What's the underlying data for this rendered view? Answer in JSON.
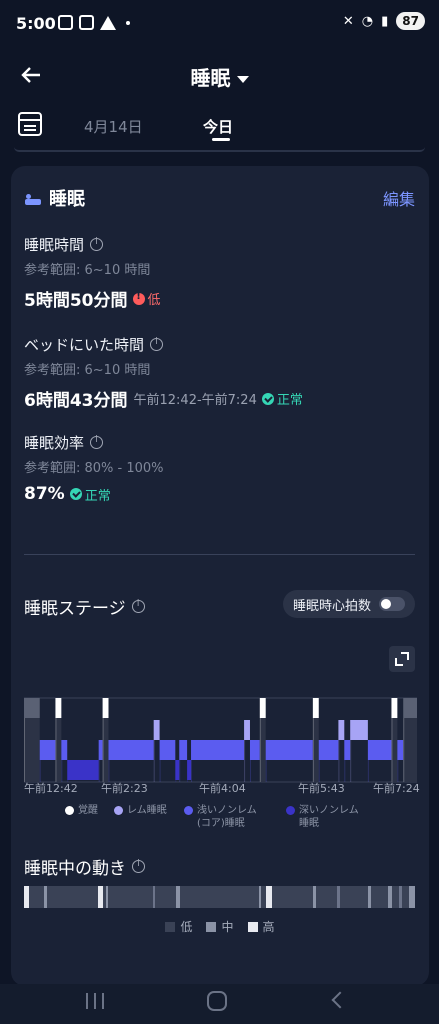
{
  "status_bar": {
    "time": "5:00",
    "battery": "87"
  },
  "header": {
    "title": "睡眠"
  },
  "date_tabs": {
    "prev": "4月14日",
    "current": "今日"
  },
  "card": {
    "title": "睡眠",
    "edit_label": "編集",
    "metrics": [
      {
        "label": "睡眠時間",
        "ref": "参考範囲: 6~10 時間",
        "value": "5時間50分間",
        "range": "",
        "badge": "低",
        "badge_type": "low"
      },
      {
        "label": "ベッドにいた時間",
        "ref": "参考範囲: 6~10 時間",
        "value": "6時間43分間",
        "range": "午前12:42-午前7:24",
        "badge": "正常",
        "badge_type": "ok"
      },
      {
        "label": "睡眠効率",
        "ref": "参考範囲: 80% - 100%",
        "value": "87%",
        "range": "",
        "badge": "正常",
        "badge_type": "ok"
      }
    ],
    "stages_title": "睡眠ステージ",
    "hr_toggle_label": "睡眠時心拍数",
    "time_labels": [
      "午前12:42",
      "午前2:23",
      "午前4:04",
      "午前5:43",
      "午前7:24"
    ],
    "legend": [
      {
        "label": "覚醒",
        "color": "#ffffff"
      },
      {
        "label": "レム睡眠",
        "color": "#a7a4f5"
      },
      {
        "label": "浅いノンレム\n(コア)睡眠",
        "color": "#5b5cf0"
      },
      {
        "label": "深いノンレム\n睡眠",
        "color": "#3a33c8"
      }
    ],
    "movement_title": "睡眠中の動き",
    "movement_legend": [
      "低",
      "中",
      "高"
    ]
  },
  "chart_data": {
    "type": "timeline",
    "title": "睡眠ステージ",
    "x_start": "午前12:42",
    "x_end": "午前7:24",
    "x_ticks": [
      "午前12:42",
      "午前2:23",
      "午前4:04",
      "午前5:43",
      "午前7:24"
    ],
    "stages": [
      "覚醒",
      "レム睡眠",
      "浅いノンレム(コア)睡眠",
      "深いノンレム睡眠"
    ],
    "segments": [
      {
        "stage": "覚醒",
        "start": 0.0,
        "end": 0.04
      },
      {
        "stage": "浅いノンレム(コア)睡眠",
        "start": 0.04,
        "end": 0.08
      },
      {
        "stage": "覚醒",
        "start": 0.08,
        "end": 0.095
      },
      {
        "stage": "浅いノンレム(コア)睡眠",
        "start": 0.095,
        "end": 0.11
      },
      {
        "stage": "深いノンレム睡眠",
        "start": 0.11,
        "end": 0.19
      },
      {
        "stage": "浅いノンレム(コア)睡眠",
        "start": 0.19,
        "end": 0.2
      },
      {
        "stage": "覚醒",
        "start": 0.2,
        "end": 0.215
      },
      {
        "stage": "浅いノンレム(コア)睡眠",
        "start": 0.215,
        "end": 0.33
      },
      {
        "stage": "レム睡眠",
        "start": 0.33,
        "end": 0.345
      },
      {
        "stage": "浅いノンレム(コア)睡眠",
        "start": 0.345,
        "end": 0.385
      },
      {
        "stage": "深いノンレム睡眠",
        "start": 0.385,
        "end": 0.395
      },
      {
        "stage": "浅いノンレム(コア)睡眠",
        "start": 0.395,
        "end": 0.415
      },
      {
        "stage": "深いノンレム睡眠",
        "start": 0.415,
        "end": 0.425
      },
      {
        "stage": "浅いノンレム(コア)睡眠",
        "start": 0.425,
        "end": 0.56
      },
      {
        "stage": "レム睡眠",
        "start": 0.56,
        "end": 0.575
      },
      {
        "stage": "浅いノンレム(コア)睡眠",
        "start": 0.575,
        "end": 0.6
      },
      {
        "stage": "覚醒",
        "start": 0.6,
        "end": 0.615
      },
      {
        "stage": "浅いノンレム(コア)睡眠",
        "start": 0.615,
        "end": 0.735
      },
      {
        "stage": "覚醒",
        "start": 0.735,
        "end": 0.75
      },
      {
        "stage": "浅いノンレム(コア)睡眠",
        "start": 0.75,
        "end": 0.8
      },
      {
        "stage": "レム睡眠",
        "start": 0.8,
        "end": 0.815
      },
      {
        "stage": "浅いノンレム(コア)睡眠",
        "start": 0.815,
        "end": 0.83
      },
      {
        "stage": "レム睡眠",
        "start": 0.83,
        "end": 0.875
      },
      {
        "stage": "浅いノンレム(コア)睡眠",
        "start": 0.875,
        "end": 0.935
      },
      {
        "stage": "覚醒",
        "start": 0.935,
        "end": 0.95
      },
      {
        "stage": "浅いノンレム(コア)睡眠",
        "start": 0.95,
        "end": 0.965
      },
      {
        "stage": "覚醒",
        "start": 0.965,
        "end": 1.0
      }
    ]
  }
}
